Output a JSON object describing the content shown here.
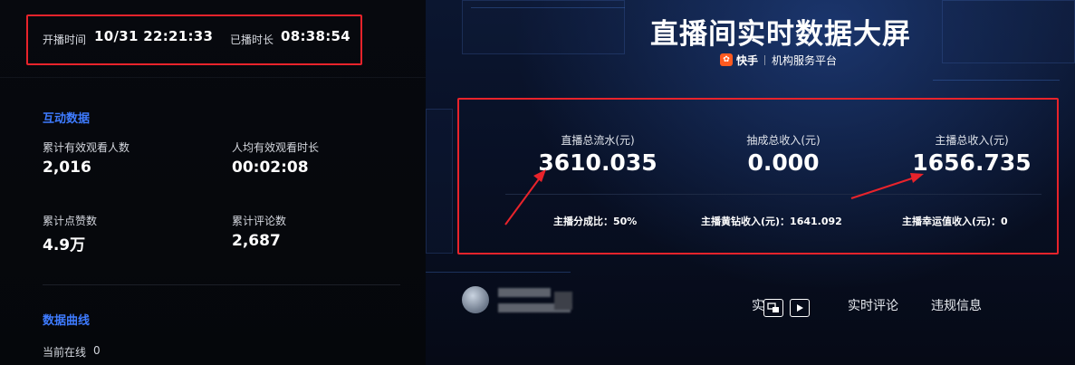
{
  "header": {
    "start_label": "开播时间",
    "start_value": "10/31 22:21:33",
    "duration_label": "已播时长",
    "duration_value": "08:38:54"
  },
  "title": "直播间实时数据大屏",
  "brand": {
    "logo_text": "快手",
    "platform": "机构服务平台"
  },
  "interaction": {
    "title": "互动数据",
    "stats": [
      {
        "label": "累计有效观看人数",
        "value": "2,016"
      },
      {
        "label": "人均有效观看时长",
        "value": "00:02:08"
      },
      {
        "label": "累计点赞数",
        "value": "4.9万"
      },
      {
        "label": "累计评论数",
        "value": "2,687"
      }
    ]
  },
  "curve": {
    "title": "数据曲线",
    "online_label": "当前在线",
    "online_value": "0"
  },
  "revenue": {
    "items": [
      {
        "label": "直播总流水(元)",
        "value": "3610.035"
      },
      {
        "label": "抽成总收入(元)",
        "value": "0.000"
      },
      {
        "label": "主播总收入(元)",
        "value": "1656.735"
      }
    ],
    "sub": [
      {
        "text": "主播分成比：50%"
      },
      {
        "text": "主播黄钻收入(元)：1641.092"
      },
      {
        "text": "主播幸运值收入(元)：0"
      }
    ]
  },
  "tabs": [
    {
      "label": "实"
    },
    {
      "label": "实时评论"
    },
    {
      "label": "违规信息"
    }
  ],
  "colors": {
    "accent": "#3e7bff",
    "highlight": "#e8232b"
  }
}
